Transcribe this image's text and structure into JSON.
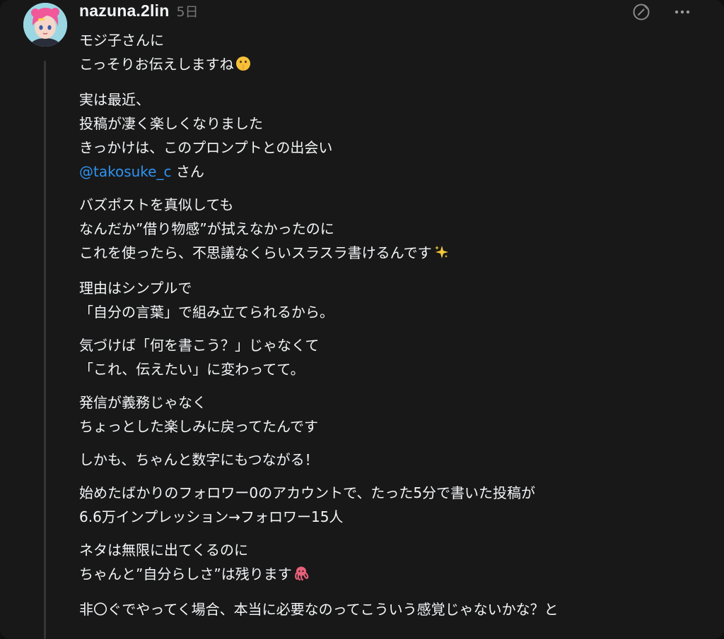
{
  "post": {
    "username": "nazuna.2lin",
    "timestamp": "5日",
    "avatar_icon": "avatar-illustration-pink-hair",
    "actions": {
      "edit_icon": "edit-slash-icon",
      "more_icon": "more-horizontal-icon"
    },
    "paragraphs": [
      {
        "lines": [
          {
            "text": "モジ子さんに"
          },
          {
            "text": "こっそりお伝えしますね",
            "emoji": "shushing-face-emoji"
          }
        ]
      },
      {
        "lines": [
          {
            "text": "実は最近、"
          },
          {
            "text": "投稿が凄く楽しくなりました"
          },
          {
            "text": "きっかけは、このプロンプトとの出会い"
          },
          {
            "mention": "@takosuke_c",
            "text": " さん"
          }
        ]
      },
      {
        "lines": [
          {
            "text": "バズポストを真似しても"
          },
          {
            "text": "なんだか”借り物感”が拭えなかったのに"
          },
          {
            "text": "これを使ったら、不思議なくらいスラスラ書けるんです",
            "emoji": "sparkles-emoji"
          }
        ]
      },
      {
        "lines": [
          {
            "text": "理由はシンプルで"
          },
          {
            "text": "「自分の言葉」で組み立てられるから。"
          }
        ]
      },
      {
        "lines": [
          {
            "text": "気づけば「何を書こう？」じゃなくて"
          },
          {
            "text": "「これ、伝えたい」に変わってて。"
          }
        ]
      },
      {
        "lines": [
          {
            "text": "発信が義務じゃなく"
          },
          {
            "text": "ちょっとした楽しみに戻ってたんです"
          }
        ]
      },
      {
        "lines": [
          {
            "text": "しかも、ちゃんと数字にもつながる！"
          }
        ]
      },
      {
        "lines": [
          {
            "text": "始めたばかりのフォロワー0のアカウントで、たった5分で書いた投稿が"
          },
          {
            "text": "6.6万インプレッション→フォロワー15人"
          }
        ]
      },
      {
        "lines": [
          {
            "text": "ネタは無限に出てくるのに"
          },
          {
            "text": "ちゃんと”自分らしさ”は残ります",
            "emoji": "octopus-emoji"
          }
        ]
      },
      {
        "lines": [
          {
            "text": "非〇ぐでやってく場合、本当に必要なのってこういう感覚じゃないかな？と"
          }
        ]
      }
    ]
  },
  "colors": {
    "background": "#181818",
    "text": "#f3f5f7",
    "muted": "#777777",
    "mention": "#2f93f0",
    "thread_line": "#333638"
  }
}
